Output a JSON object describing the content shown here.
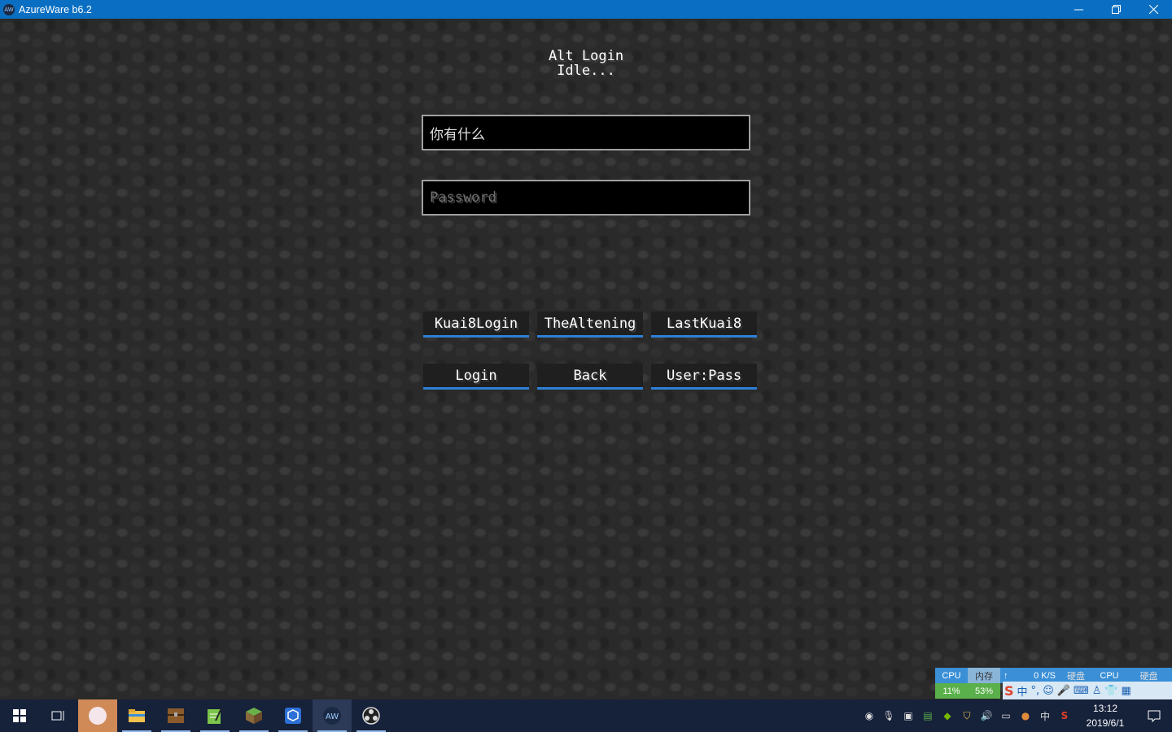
{
  "window": {
    "title": "AzureWare b6.2",
    "icon_text": "AW"
  },
  "screen": {
    "heading": "Alt Login",
    "status": "Idle...",
    "username_value": "你有什么",
    "password_placeholder": "Password"
  },
  "buttons": {
    "row1": [
      "Kuai8Login",
      "TheAltening",
      "LastKuai8"
    ],
    "row2": [
      "Login",
      "Back",
      "User:Pass"
    ]
  },
  "monitor": {
    "cpu_label": "CPU",
    "cpu_value": "11%",
    "mem_label": "内存",
    "mem_value": "53%",
    "net_up": "0 K/S",
    "disk_label": "硬盘",
    "cpu2_label": "CPU",
    "disk2_label": "硬盘"
  },
  "tray": {
    "ime_lang": "中",
    "time": "13:12",
    "date": "2019/6/1"
  },
  "colors": {
    "titlebar": "#0a6fc2",
    "button_accent": "#2e7fd6",
    "taskbar": "#16213a"
  }
}
